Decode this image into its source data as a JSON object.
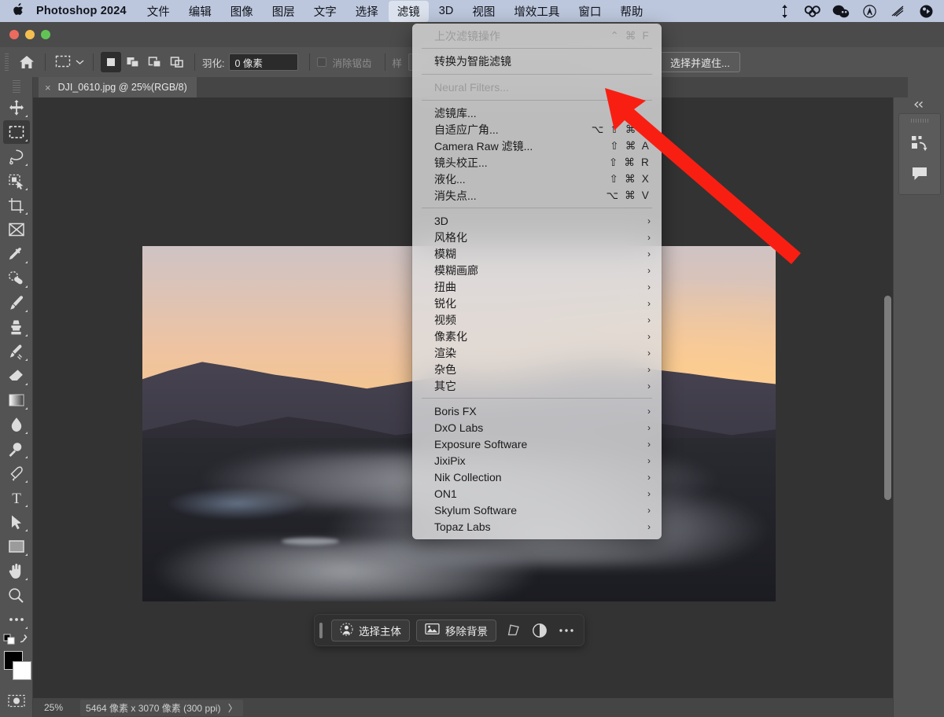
{
  "macbar": {
    "apple_icon": "apple-logo-icon",
    "app_name": "Photoshop 2024",
    "menus": [
      {
        "label": "文件",
        "active": false
      },
      {
        "label": "编辑",
        "active": false
      },
      {
        "label": "图像",
        "active": false
      },
      {
        "label": "图层",
        "active": false
      },
      {
        "label": "文字",
        "active": false
      },
      {
        "label": "选择",
        "active": false
      },
      {
        "label": "滤镜",
        "active": true
      },
      {
        "label": "3D",
        "active": false
      },
      {
        "label": "视图",
        "active": false
      },
      {
        "label": "增效工具",
        "active": false
      },
      {
        "label": "窗口",
        "active": false
      },
      {
        "label": "帮助",
        "active": false
      }
    ],
    "tray": [
      {
        "name": "updown-arrows-icon",
        "glyph": "↕"
      },
      {
        "name": "dropbox-icon",
        "glyph": "⚭"
      },
      {
        "name": "wechat-icon",
        "glyph": "✿"
      },
      {
        "name": "circle-a-icon",
        "glyph": "Ⓐ"
      },
      {
        "name": "sound-waves-icon",
        "glyph": "⌇"
      },
      {
        "name": "control-center-icon",
        "glyph": "⚙"
      }
    ]
  },
  "window": {
    "traffic_lights": [
      "close-button",
      "minimize-button",
      "maximize-button"
    ]
  },
  "options_bar": {
    "home_icon": "home-icon",
    "tool_icon": "rectangular-marquee-icon",
    "tool_chevron": "chevron-down-icon",
    "boolean_ops": [
      {
        "name": "new-selection",
        "selected": true
      },
      {
        "name": "add-to-selection",
        "selected": false
      },
      {
        "name": "subtract-from-selection",
        "selected": false
      },
      {
        "name": "intersect-selection",
        "selected": false
      }
    ],
    "feather_label": "羽化:",
    "feather_value": "0 像素",
    "antialias_label": "消除锯齿",
    "antialias_checked": false,
    "style_label": "样",
    "select_and_mask_label": "选择并遮住..."
  },
  "document": {
    "tab_title": "DJI_0610.jpg @ 25%(RGB/8)",
    "close_glyph": "×"
  },
  "toolbar": {
    "tools": [
      {
        "name": "move-tool",
        "glyph": "✥",
        "selected": false,
        "has_more": true
      },
      {
        "name": "rectangular-marquee-tool",
        "glyph": "⬚",
        "selected": true,
        "has_more": true
      },
      {
        "name": "lasso-tool",
        "glyph": "⚲",
        "selected": false,
        "has_more": true
      },
      {
        "name": "quick-selection-tool",
        "glyph": "⬛",
        "selected": false,
        "has_more": true
      },
      {
        "name": "crop-tool",
        "glyph": "⌗",
        "selected": false,
        "has_more": true
      },
      {
        "name": "frame-tool",
        "glyph": "⌧",
        "selected": false,
        "has_more": false
      },
      {
        "name": "eyedropper-tool",
        "glyph": "☂",
        "selected": false,
        "has_more": true
      },
      {
        "name": "spot-healing-brush-tool",
        "glyph": "❀",
        "selected": false,
        "has_more": true
      },
      {
        "name": "brush-tool",
        "glyph": "✐",
        "selected": false,
        "has_more": true
      },
      {
        "name": "clone-stamp-tool",
        "glyph": "♟",
        "selected": false,
        "has_more": true
      },
      {
        "name": "history-brush-tool",
        "glyph": "✒",
        "selected": false,
        "has_more": true
      },
      {
        "name": "eraser-tool",
        "glyph": "▱",
        "selected": false,
        "has_more": true
      },
      {
        "name": "gradient-tool",
        "glyph": "▣",
        "selected": false,
        "has_more": true
      },
      {
        "name": "blur-tool",
        "glyph": "●",
        "selected": false,
        "has_more": true
      },
      {
        "name": "dodge-tool",
        "glyph": "⚲",
        "selected": false,
        "has_more": true
      },
      {
        "name": "pen-tool",
        "glyph": "✑",
        "selected": false,
        "has_more": true
      },
      {
        "name": "type-tool",
        "glyph": "T",
        "selected": false,
        "has_more": true
      },
      {
        "name": "path-selection-tool",
        "glyph": "➤",
        "selected": false,
        "has_more": true
      },
      {
        "name": "rectangle-tool",
        "glyph": "▭",
        "selected": false,
        "has_more": true
      },
      {
        "name": "hand-tool",
        "glyph": "✋",
        "selected": false,
        "has_more": true
      },
      {
        "name": "zoom-tool",
        "glyph": "⚲",
        "selected": false,
        "has_more": false
      },
      {
        "name": "edit-toolbar-more",
        "glyph": "…",
        "selected": false,
        "has_more": true
      }
    ],
    "foreground_color": "#000000",
    "background_color": "#ffffff",
    "swap_colors_icon": "swap-colors-icon",
    "default_colors_icon": "default-colors-icon",
    "quick_mask_icon": "quick-mask-icon"
  },
  "contextual_task_bar": {
    "buttons": [
      {
        "name": "select-subject-button",
        "label": "选择主体",
        "icon": "person-selection-icon"
      },
      {
        "name": "remove-background-button",
        "label": "移除背景",
        "icon": "image-icon"
      }
    ],
    "icons": [
      {
        "name": "transform-warp-icon",
        "glyph": "⬡"
      },
      {
        "name": "adjustment-layer-icon",
        "glyph": "◐"
      },
      {
        "name": "more-options-icon",
        "glyph": "⋯"
      }
    ]
  },
  "right_panel": {
    "collapse_icon": "chevron-double-left-icon",
    "items": [
      {
        "name": "history-states-icon",
        "glyph": "↺"
      },
      {
        "name": "comments-icon",
        "glyph": "὞a"
      }
    ]
  },
  "status_bar": {
    "zoom": "25%",
    "dimensions": "5464 像素 x 3070 像素 (300 ppi)",
    "expand_glyph": "〉"
  },
  "filter_menu": {
    "groups": [
      {
        "items": [
          {
            "label": "上次滤镜操作",
            "shortcut": "⌃ ⌘ F",
            "disabled": true,
            "submenu": false
          }
        ]
      },
      {
        "items": [
          {
            "label": "转换为智能滤镜",
            "shortcut": "",
            "disabled": false,
            "submenu": false
          }
        ]
      },
      {
        "items": [
          {
            "label": "Neural Filters...",
            "shortcut": "",
            "disabled": true,
            "submenu": false
          }
        ]
      },
      {
        "items": [
          {
            "label": "滤镜库...",
            "shortcut": "",
            "disabled": false,
            "submenu": false
          },
          {
            "label": "自适应广角...",
            "shortcut": "⌥ ⇧ ⌘ A",
            "disabled": false,
            "submenu": false
          },
          {
            "label": "Camera Raw 滤镜...",
            "shortcut": "⇧ ⌘ A",
            "disabled": false,
            "submenu": false
          },
          {
            "label": "镜头校正...",
            "shortcut": "⇧ ⌘ R",
            "disabled": false,
            "submenu": false
          },
          {
            "label": "液化...",
            "shortcut": "⇧ ⌘ X",
            "disabled": false,
            "submenu": false
          },
          {
            "label": "消失点...",
            "shortcut": "⌥ ⌘ V",
            "disabled": false,
            "submenu": false
          }
        ]
      },
      {
        "items": [
          {
            "label": "3D",
            "shortcut": "",
            "disabled": false,
            "submenu": true
          },
          {
            "label": "风格化",
            "shortcut": "",
            "disabled": false,
            "submenu": true
          },
          {
            "label": "模糊",
            "shortcut": "",
            "disabled": false,
            "submenu": true
          },
          {
            "label": "模糊画廊",
            "shortcut": "",
            "disabled": false,
            "submenu": true
          },
          {
            "label": "扭曲",
            "shortcut": "",
            "disabled": false,
            "submenu": true
          },
          {
            "label": "锐化",
            "shortcut": "",
            "disabled": false,
            "submenu": true
          },
          {
            "label": "视频",
            "shortcut": "",
            "disabled": false,
            "submenu": true
          },
          {
            "label": "像素化",
            "shortcut": "",
            "disabled": false,
            "submenu": true
          },
          {
            "label": "渲染",
            "shortcut": "",
            "disabled": false,
            "submenu": true
          },
          {
            "label": "杂色",
            "shortcut": "",
            "disabled": false,
            "submenu": true
          },
          {
            "label": "其它",
            "shortcut": "",
            "disabled": false,
            "submenu": true
          }
        ]
      },
      {
        "items": [
          {
            "label": "Boris FX",
            "shortcut": "",
            "disabled": false,
            "submenu": true
          },
          {
            "label": "DxO Labs",
            "shortcut": "",
            "disabled": false,
            "submenu": true
          },
          {
            "label": "Exposure Software",
            "shortcut": "",
            "disabled": false,
            "submenu": true
          },
          {
            "label": "JixiPix",
            "shortcut": "",
            "disabled": false,
            "submenu": true
          },
          {
            "label": "Nik Collection",
            "shortcut": "",
            "disabled": false,
            "submenu": true
          },
          {
            "label": "ON1",
            "shortcut": "",
            "disabled": false,
            "submenu": true
          },
          {
            "label": "Skylum Software",
            "shortcut": "",
            "disabled": false,
            "submenu": true
          },
          {
            "label": "Topaz Labs",
            "shortcut": "",
            "disabled": false,
            "submenu": true
          }
        ]
      }
    ]
  },
  "annotation": {
    "arrow_color": "#f81f12",
    "points_to": "Neural Filters..."
  },
  "colors": {
    "menubar_bg": "#bcc7dd",
    "app_chrome": "#535353",
    "canvas_bg": "#333333",
    "menu_bg": "#dedee0",
    "accent_red": "#f81f12"
  }
}
